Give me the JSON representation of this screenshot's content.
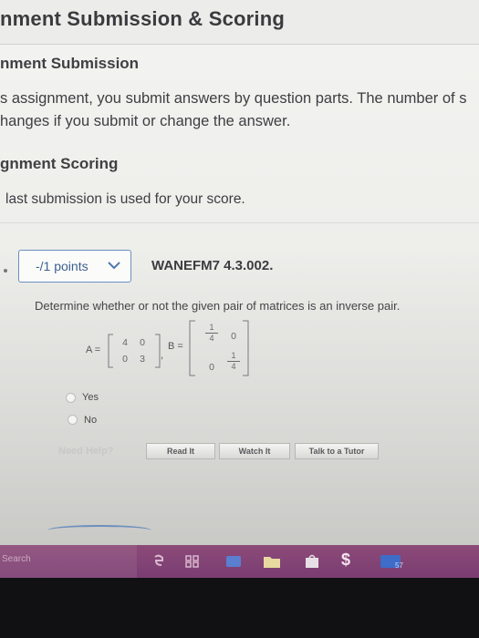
{
  "page": {
    "title": "nment Submission & Scoring",
    "submission_heading": "nment Submission",
    "submission_line1": "s assignment, you submit answers by question parts. The number of s",
    "submission_line2": "hanges if you submit or change the answer.",
    "scoring_heading": "gnment Scoring",
    "scoring_line": "last submission is used for your score."
  },
  "question": {
    "points_label": "-/1 points",
    "id": "WANEFM7 4.3.002.",
    "prompt": "Determine whether or not the given pair of matrices is an inverse pair.",
    "matrix_a": {
      "label": "A =",
      "values": [
        "4",
        "0",
        "0",
        "3"
      ]
    },
    "matrix_b": {
      "label": "B =",
      "cells": [
        {
          "num": "1",
          "den": "4"
        },
        "0",
        "0",
        {
          "num": "1",
          "den": "4"
        }
      ]
    },
    "options": [
      "Yes",
      "No"
    ]
  },
  "help": {
    "label": "Need Help?",
    "buttons": [
      "Read It",
      "Watch It",
      "Talk to a Tutor"
    ]
  },
  "taskbar": {
    "search_label": "Search",
    "badge": "57"
  },
  "colors": {
    "accent": "#6a8fbf",
    "taskbar": "#7a3d72"
  },
  "icons": [
    "chevron-down-icon",
    "edge-icon",
    "task-view-icon",
    "store-icon",
    "folder-icon",
    "bag-icon",
    "dollar-icon",
    "app-icon"
  ]
}
